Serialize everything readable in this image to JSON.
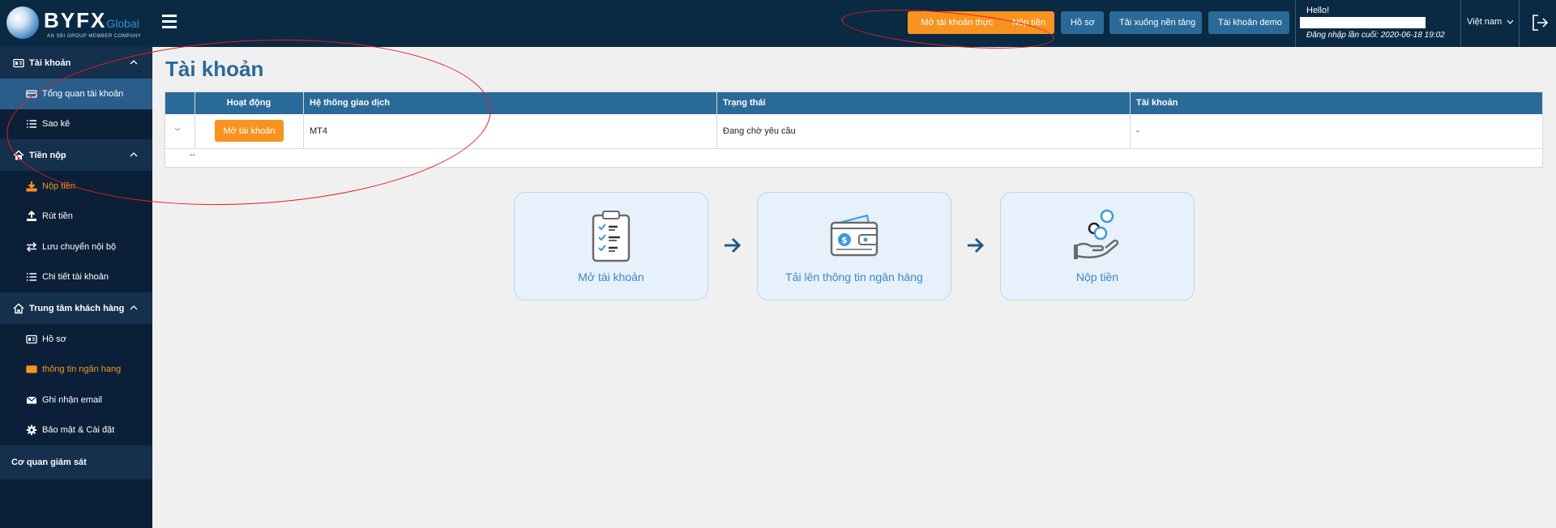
{
  "brand": {
    "name": "BYFX",
    "suffix": "Global",
    "tagline": "AN SBI GROUP MEMBER COMPANY"
  },
  "topbar": {
    "buttons": [
      {
        "label": "Mở tài khoản thực",
        "color": "#f7931e"
      },
      {
        "label": "Nộp tiền",
        "color": "#f7931e"
      },
      {
        "label": "Hồ sơ",
        "color": "#2a6a98"
      },
      {
        "label": "Tải xuống nền tảng",
        "color": "#2a6a98"
      },
      {
        "label": "Tài khoản demo",
        "color": "#2a6a98"
      }
    ],
    "hello": "Hello!",
    "last_login": "Đăng nhập lần cuối: 2020-06-18 19:02",
    "language": "Việt nam"
  },
  "sidebar": {
    "groups": [
      {
        "label": "Tài khoản",
        "items": [
          {
            "label": "Tổng quan tài khoản",
            "active": true
          },
          {
            "label": "Sao kê"
          }
        ]
      },
      {
        "label": "Tiền nộp",
        "items": [
          {
            "label": "Nộp tiền",
            "highlight": true
          },
          {
            "label": "Rút tiền"
          },
          {
            "label": "Lưu chuyển nội bộ"
          },
          {
            "label": "Chi tiết tài khoản"
          }
        ]
      },
      {
        "label": "Trung tâm khách hàng",
        "items": [
          {
            "label": "Hồ sơ"
          },
          {
            "label": "thông tin ngân hang",
            "highlight": true
          },
          {
            "label": "Ghi nhận email"
          },
          {
            "label": "Bảo mật & Cài đặt"
          }
        ]
      }
    ],
    "standalone": "Cơ quan giám sát"
  },
  "main": {
    "title": "Tài khoản",
    "table": {
      "columns": [
        "Hoạt động",
        "Hệ thống giao dịch",
        "Trạng thái",
        "Tài khoản"
      ],
      "row": {
        "action": "Mở tài khoản",
        "platform": "MT4",
        "status": "Đang chờ yêu cầu",
        "account": "-"
      },
      "footer": "--"
    },
    "steps": [
      {
        "label": "Mở tài khoản",
        "icon": "clipboard-checklist-icon"
      },
      {
        "label": "Tải lên thông tin ngân hàng",
        "icon": "wallet-icon"
      },
      {
        "label": "Nộp tiền",
        "icon": "hand-coins-icon"
      }
    ]
  },
  "colors": {
    "navy": "#0a2a44",
    "accent_orange": "#f7931e",
    "accent_blue": "#2a6a98",
    "annotation_red": "#e02020"
  }
}
